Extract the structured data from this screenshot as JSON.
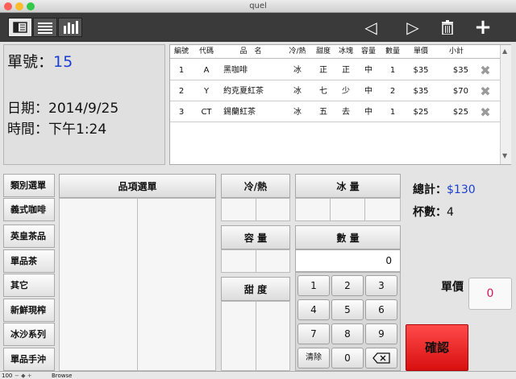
{
  "window": {
    "title": "quel"
  },
  "toolbar": {
    "prev_icon": "◁",
    "next_icon": "▷",
    "delete_icon": "🗑",
    "add_icon": "+"
  },
  "order": {
    "number_label": "單號：",
    "number_value": "15",
    "date_label": "日期：",
    "date_value": "2014/9/25",
    "time_label": "時間：",
    "time_value": "下午1:24"
  },
  "table": {
    "headers": [
      "編號",
      "代碼",
      "品　名",
      "冷/熱",
      "甜度",
      "冰塊",
      "容量",
      "數量",
      "單價",
      "小計"
    ],
    "rows": [
      [
        "1",
        "A",
        "黑咖啡",
        "冰",
        "正",
        "正",
        "中",
        "1",
        "$35",
        "$35"
      ],
      [
        "2",
        "Y",
        "約克夏紅茶",
        "冰",
        "七",
        "少",
        "中",
        "2",
        "$35",
        "$70"
      ],
      [
        "3",
        "CT",
        "錫蘭紅茶",
        "冰",
        "五",
        "去",
        "中",
        "1",
        "$25",
        "$25"
      ]
    ]
  },
  "categories": [
    "類別選單",
    "義式咖啡",
    "英皇茶品",
    "單品茶",
    "其它",
    "新鮮現榨",
    "冰沙系列",
    "單品手沖"
  ],
  "item_menu_header": "品項選單",
  "hot_cold_header": "冷/熱",
  "capacity_header": "容  量",
  "sweetness_header": "甜 度",
  "ice_header": "冰  量",
  "quantity_header": "數  量",
  "quantity_value": "0",
  "keypad": [
    "1",
    "2",
    "3",
    "4",
    "5",
    "6",
    "7",
    "8",
    "9",
    "清除",
    "0",
    "⌫"
  ],
  "summary": {
    "total_label": "總計：",
    "total_value": "$130",
    "cups_label": "杯數：",
    "cups_value": "4",
    "unit_price_label": "單價",
    "unit_price_value": "0",
    "confirm_label": "確認"
  },
  "statusbar": {
    "zoom": "100",
    "mode": "Browse"
  },
  "colors": {
    "accent_blue": "#1a3fd0",
    "confirm_red": "#e81c1c",
    "price_red": "#d4145a"
  }
}
